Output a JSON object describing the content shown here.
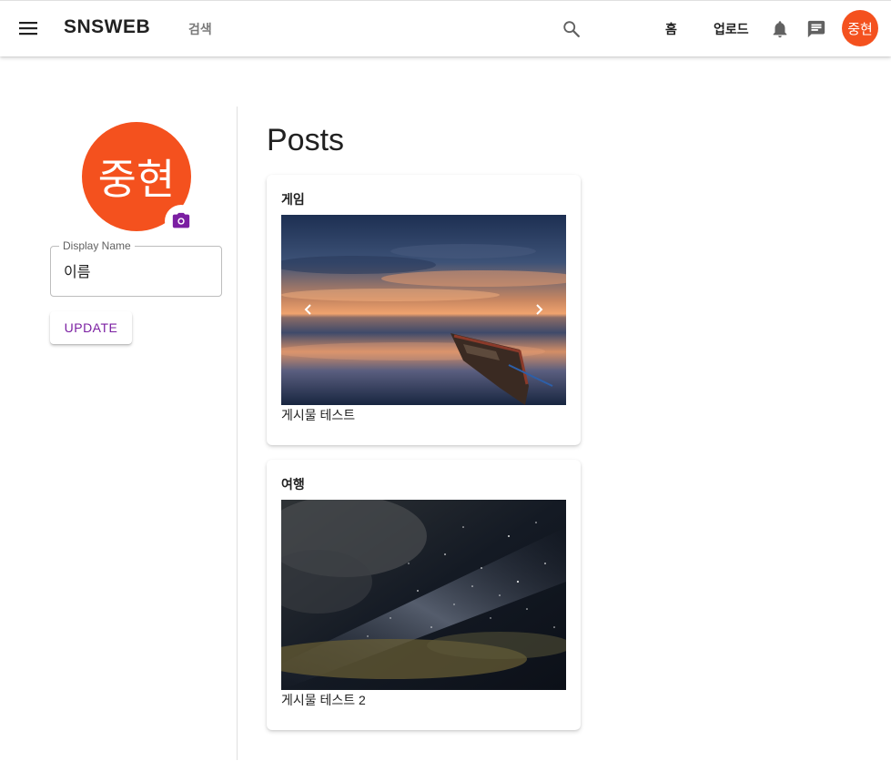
{
  "appbar": {
    "brand": "SNSWEB",
    "search_link": "검색",
    "nav_home": "홈",
    "nav_upload": "업로드",
    "avatar_text": "중현",
    "icons": [
      "menu-icon",
      "search-icon",
      "bell-icon",
      "chat-icon"
    ]
  },
  "profile": {
    "avatar_text": "중현",
    "display_name_label": "Display Name",
    "display_name_value": "이름",
    "update_label": "UPDATE",
    "accent_color": "#7b1fa2",
    "avatar_color": "#f4511e"
  },
  "posts": {
    "title": "Posts",
    "items": [
      {
        "title": "게임",
        "caption": "게시물 테스트",
        "image": "sunset lake with wooden boat"
      },
      {
        "title": "여행",
        "caption": "게시물 테스트 2",
        "image": "starry night sky with milky way"
      }
    ]
  }
}
